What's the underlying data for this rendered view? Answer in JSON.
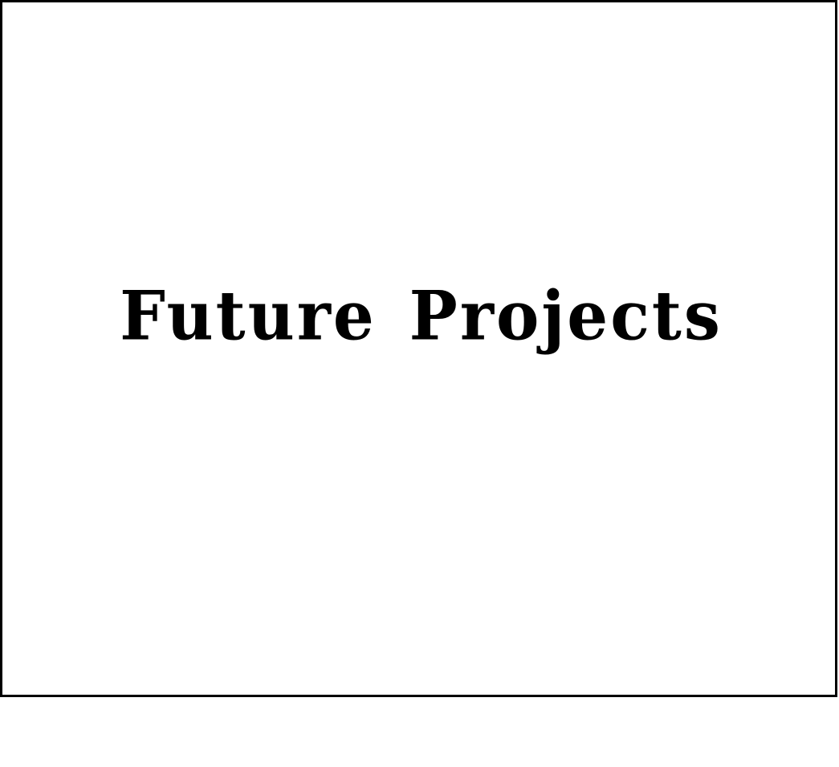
{
  "slide": {
    "title": "Future Projects"
  },
  "colors": {
    "background": "#ffffff",
    "border": "#000000",
    "text": "#000000"
  }
}
